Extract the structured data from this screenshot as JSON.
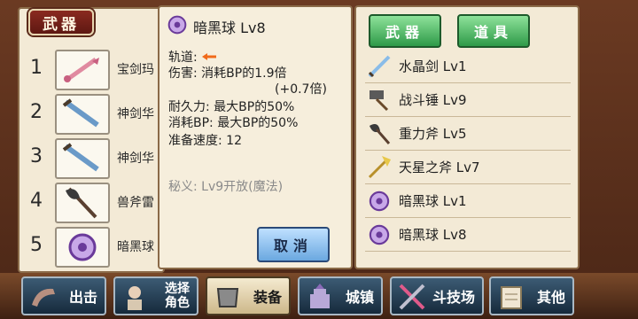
{
  "left": {
    "tab_label": "武器",
    "slots": [
      {
        "num": "1",
        "name": "宝剑玛",
        "icon": "pink-sword-icon"
      },
      {
        "num": "2",
        "name": "神剑华",
        "icon": "blue-sword-icon"
      },
      {
        "num": "3",
        "name": "神剑华",
        "icon": "blue-sword-icon"
      },
      {
        "num": "4",
        "name": "兽斧雷",
        "icon": "axe-icon"
      },
      {
        "num": "5",
        "name": "暗黑球",
        "icon": "dark-orb-icon"
      }
    ]
  },
  "detail": {
    "title": "暗黑球 Lv8",
    "trajectory_label": "轨道:",
    "damage": "伤害: 消耗BP的1.9倍",
    "damage_bonus": "(+0.7倍)",
    "durability": "耐久力: 最大BP的50%",
    "bp_cost": "消耗BP: 最大BP的50%",
    "prep_speed": "准备速度: 12",
    "secret": "秘义:  Lv9开放(魔法)",
    "cancel_label": "取消"
  },
  "right": {
    "tab_weapon": "武器",
    "tab_item": "道具",
    "items": [
      {
        "name": "水晶剑 Lv1",
        "icon": "crystal-sword-icon"
      },
      {
        "name": "战斗锤 Lv9",
        "icon": "hammer-icon"
      },
      {
        "name": "重力斧 Lv5",
        "icon": "gravity-axe-icon"
      },
      {
        "name": "天星之斧 Lv7",
        "icon": "star-axe-icon"
      },
      {
        "name": "暗黑球 Lv1",
        "icon": "dark-orb-icon"
      },
      {
        "name": "暗黑球 Lv8",
        "icon": "dark-orb-icon"
      }
    ]
  },
  "nav": {
    "sortie": "出击",
    "select_char_1": "选择",
    "select_char_2": "角色",
    "equip": "装备",
    "town": "城镇",
    "arena": "斗技场",
    "other": "其他"
  },
  "colors": {
    "tab_green": "#2e9a48",
    "tab_red": "#8a2a20",
    "cancel_blue": "#6aa8e0",
    "arrow_orange": "#f06a1a"
  }
}
